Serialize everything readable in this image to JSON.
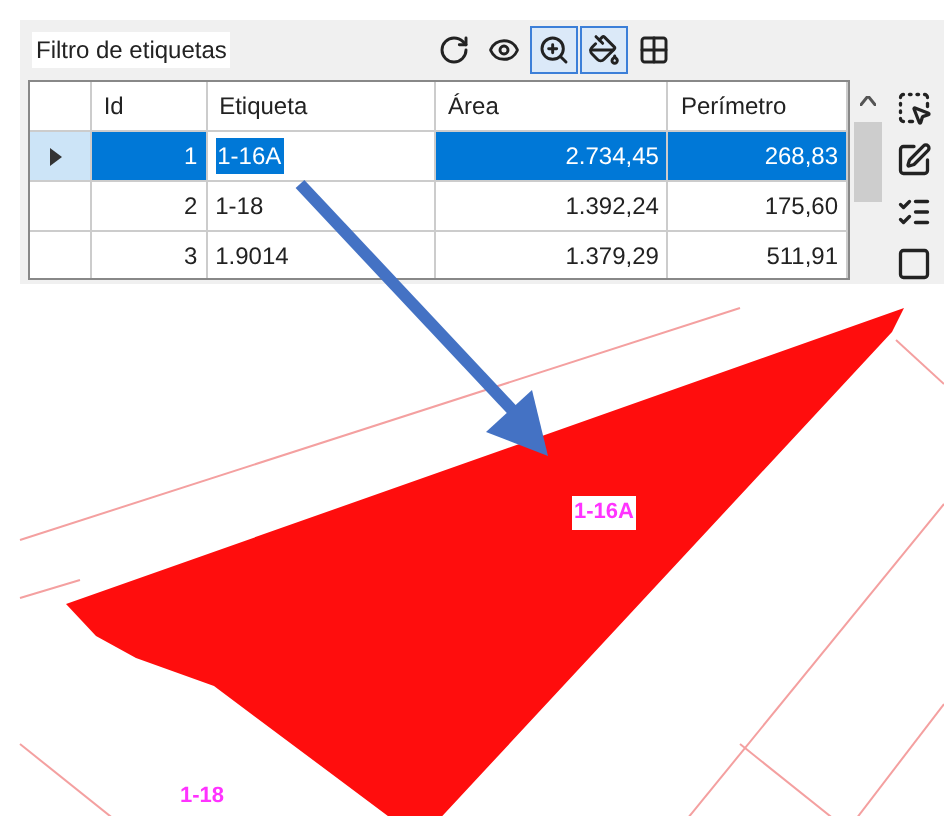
{
  "panel": {
    "title": "Filtro de etiquetas"
  },
  "toolbar": [
    {
      "kind": "refresh",
      "selected": false
    },
    {
      "kind": "view",
      "selected": false
    },
    {
      "kind": "zoom",
      "selected": true
    },
    {
      "kind": "fill",
      "selected": true
    },
    {
      "kind": "grid",
      "selected": false
    }
  ],
  "table": {
    "columns": [
      "Id",
      "Etiqueta",
      "Área",
      "Perímetro"
    ],
    "rows": [
      {
        "cells": [
          "1",
          "1-16A",
          "2.734,45",
          "268,83"
        ],
        "selected": true
      },
      {
        "cells": [
          "2",
          "1-18",
          "1.392,24",
          "175,60"
        ],
        "selected": false
      },
      {
        "cells": [
          "3",
          "1.9014",
          "1.379,29",
          "511,91"
        ],
        "selected": false
      }
    ]
  },
  "side_tools": [
    {
      "kind": "select"
    },
    {
      "kind": "edit"
    },
    {
      "kind": "list"
    },
    {
      "kind": "block"
    }
  ],
  "map": {
    "labels": [
      {
        "text": "1-16A",
        "selected": true
      },
      {
        "text": "1-18",
        "selected": false
      }
    ]
  }
}
